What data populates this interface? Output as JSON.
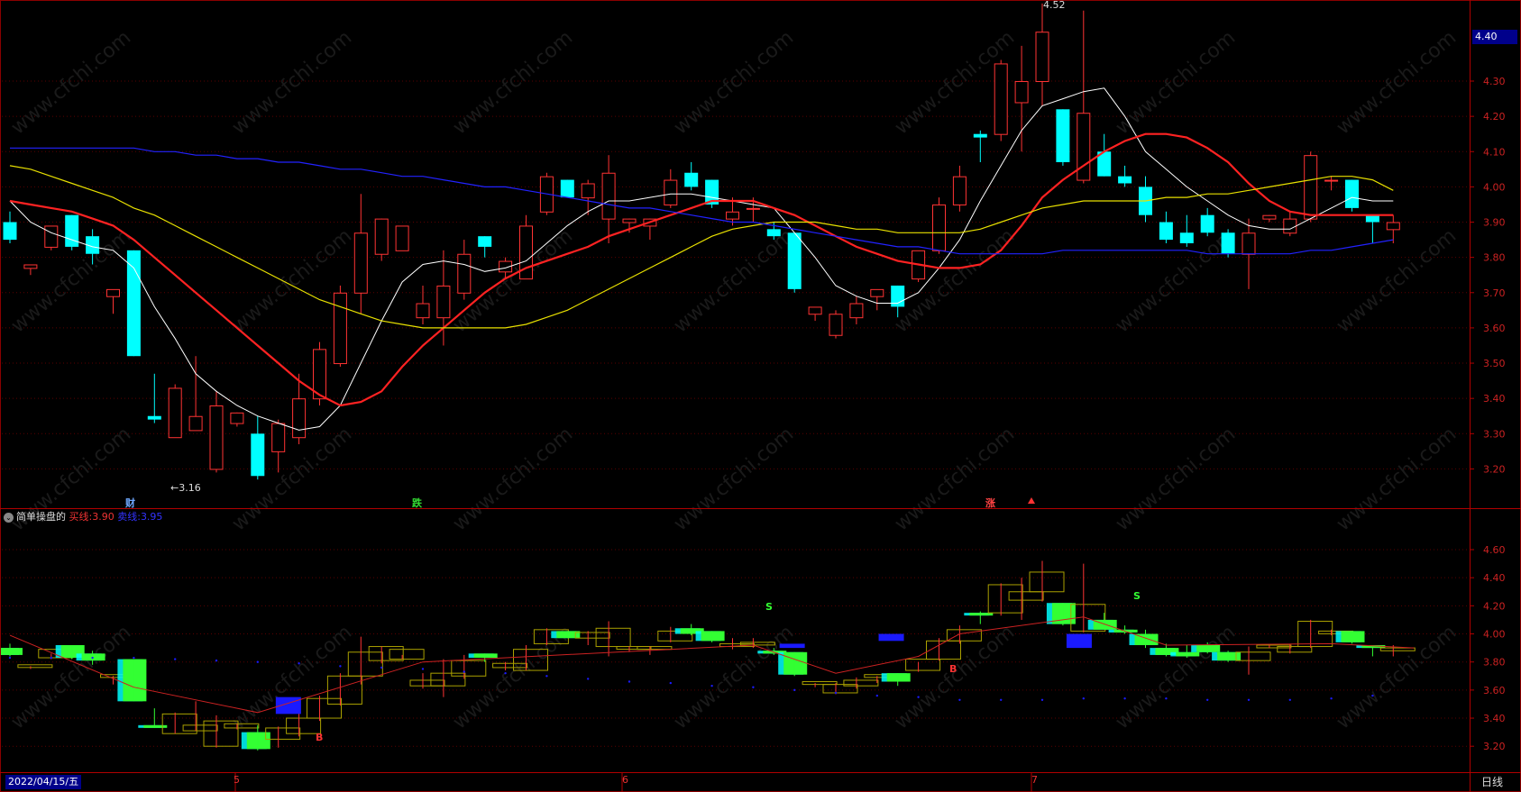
{
  "main_chart": {
    "max_label": "4.52",
    "min_label": "←3.16",
    "current_price": "4.40",
    "y_ticks": [
      "4.30",
      "4.20",
      "4.10",
      "4.00",
      "3.90",
      "3.80",
      "3.70",
      "3.60",
      "3.50",
      "3.40",
      "3.30",
      "3.20"
    ],
    "markers": [
      {
        "text": "财",
        "color": "#6ea8ff"
      },
      {
        "text": "跌",
        "color": "#33dd33"
      },
      {
        "text": "涨",
        "color": "#ff4444"
      }
    ]
  },
  "indicator": {
    "toggle_symbol": "⌄",
    "name": "简单操盘的",
    "line1_label": "买线:",
    "line1_value": "3.90",
    "line2_label": "卖线:",
    "line2_value": "3.95",
    "y_ticks": [
      "4.60",
      "4.40",
      "4.20",
      "4.00",
      "3.80",
      "3.60",
      "3.40",
      "3.20"
    ],
    "signals": [
      "B",
      "B",
      "S",
      "S"
    ]
  },
  "footer": {
    "date": "2022/04/15/五",
    "months": [
      "5",
      "6",
      "7"
    ],
    "period": "日线"
  },
  "colors": {
    "up": "#ff3333",
    "down": "#00ffff",
    "ma5": "#ffffff",
    "ma10": "#ff2222",
    "ma20": "#e8e000",
    "ma60": "#2222ff",
    "ind_down": "#33ff33",
    "ind_up": "#aaa000",
    "ind_marker": "#1a1aff"
  },
  "chart_data": {
    "type": "candlestick",
    "x": [
      1,
      2,
      3,
      4,
      5,
      6,
      7,
      8,
      9,
      10,
      11,
      12,
      13,
      14,
      15,
      16,
      17,
      18,
      19,
      20,
      21,
      22,
      23,
      24,
      25,
      26,
      27,
      28,
      29,
      30,
      31,
      32,
      33,
      34,
      35,
      36,
      37,
      38,
      39,
      40,
      41,
      42,
      43,
      44,
      45,
      46,
      47,
      48,
      49,
      50,
      51,
      52,
      53,
      54,
      55,
      56,
      57,
      58,
      59,
      60,
      61,
      62,
      63,
      64,
      65,
      66,
      67,
      68
    ],
    "ohlc": [
      [
        3.9,
        3.93,
        3.85,
        3.84
      ],
      [
        3.77,
        3.77,
        3.78,
        3.75
      ],
      [
        3.83,
        3.86,
        3.89,
        3.82
      ],
      [
        3.92,
        3.92,
        3.83,
        3.82
      ],
      [
        3.86,
        3.88,
        3.81,
        3.78
      ],
      [
        3.69,
        3.7,
        3.71,
        3.64
      ],
      [
        3.82,
        3.82,
        3.52,
        3.52
      ],
      [
        3.35,
        3.47,
        3.34,
        3.33
      ],
      [
        3.29,
        3.44,
        3.43,
        3.29
      ],
      [
        3.31,
        3.52,
        3.35,
        3.31
      ],
      [
        3.2,
        3.42,
        3.38,
        3.19
      ],
      [
        3.33,
        3.36,
        3.36,
        3.32
      ],
      [
        3.3,
        3.35,
        3.18,
        3.17
      ],
      [
        3.25,
        3.34,
        3.33,
        3.19
      ],
      [
        3.29,
        3.47,
        3.4,
        3.27
      ],
      [
        3.4,
        3.56,
        3.54,
        3.38
      ],
      [
        3.5,
        3.72,
        3.7,
        3.49
      ],
      [
        3.7,
        3.98,
        3.87,
        3.64
      ],
      [
        3.81,
        3.91,
        3.91,
        3.79
      ],
      [
        3.82,
        3.85,
        3.89,
        3.82
      ],
      [
        3.63,
        3.72,
        3.67,
        3.61
      ],
      [
        3.63,
        3.82,
        3.72,
        3.55
      ],
      [
        3.7,
        3.85,
        3.81,
        3.68
      ],
      [
        3.86,
        3.86,
        3.83,
        3.8
      ],
      [
        3.76,
        3.8,
        3.79,
        3.74
      ],
      [
        3.74,
        3.92,
        3.89,
        3.74
      ],
      [
        3.93,
        4.04,
        4.03,
        3.92
      ],
      [
        4.02,
        4.02,
        3.97,
        3.97
      ],
      [
        3.97,
        4.02,
        4.01,
        3.92
      ],
      [
        3.91,
        4.09,
        4.04,
        3.84
      ],
      [
        3.9,
        3.91,
        3.91,
        3.87
      ],
      [
        3.89,
        3.91,
        3.91,
        3.85
      ],
      [
        3.95,
        4.05,
        4.02,
        3.94
      ],
      [
        4.04,
        4.07,
        4.0,
        3.99
      ],
      [
        4.02,
        4.02,
        3.95,
        3.94
      ],
      [
        3.91,
        3.97,
        3.93,
        3.89
      ],
      [
        3.94,
        3.97,
        3.94,
        3.9
      ],
      [
        3.88,
        3.9,
        3.86,
        3.85
      ],
      [
        3.87,
        3.87,
        3.71,
        3.7
      ],
      [
        3.64,
        3.65,
        3.66,
        3.62
      ],
      [
        3.58,
        3.65,
        3.64,
        3.57
      ],
      [
        3.63,
        3.69,
        3.67,
        3.61
      ],
      [
        3.69,
        3.7,
        3.71,
        3.65
      ],
      [
        3.72,
        3.72,
        3.66,
        3.63
      ],
      [
        3.74,
        3.8,
        3.82,
        3.73
      ],
      [
        3.82,
        3.97,
        3.95,
        3.81
      ],
      [
        3.95,
        4.06,
        4.03,
        3.93
      ],
      [
        4.15,
        4.16,
        4.14,
        4.07
      ],
      [
        4.15,
        4.36,
        4.35,
        4.13
      ],
      [
        4.24,
        4.4,
        4.3,
        4.1
      ],
      [
        4.3,
        4.52,
        4.44,
        4.23
      ],
      [
        4.22,
        4.22,
        4.07,
        4.06
      ],
      [
        4.02,
        4.5,
        4.21,
        4.01
      ],
      [
        4.1,
        4.15,
        4.03,
        4.03
      ],
      [
        4.03,
        4.06,
        4.01,
        4.0
      ],
      [
        4.0,
        4.03,
        3.92,
        3.9
      ],
      [
        3.9,
        3.93,
        3.85,
        3.84
      ],
      [
        3.87,
        3.92,
        3.84,
        3.83
      ],
      [
        3.92,
        3.94,
        3.87,
        3.86
      ],
      [
        3.87,
        3.88,
        3.81,
        3.8
      ],
      [
        3.81,
        3.91,
        3.87,
        3.71
      ],
      [
        3.91,
        3.92,
        3.92,
        3.9
      ],
      [
        3.87,
        3.93,
        3.91,
        3.86
      ],
      [
        3.91,
        4.1,
        4.09,
        3.9
      ],
      [
        4.02,
        4.03,
        4.02,
        3.99
      ],
      [
        4.02,
        4.02,
        3.94,
        3.93
      ],
      [
        3.92,
        3.92,
        3.9,
        3.84
      ],
      [
        3.88,
        3.92,
        3.9,
        3.84
      ]
    ],
    "series": [
      {
        "name": "MA5",
        "values": [
          3.96,
          3.9,
          3.87,
          3.85,
          3.83,
          3.82,
          3.77,
          3.66,
          3.57,
          3.47,
          3.42,
          3.38,
          3.35,
          3.33,
          3.31,
          3.32,
          3.38,
          3.5,
          3.62,
          3.73,
          3.78,
          3.79,
          3.78,
          3.76,
          3.77,
          3.79,
          3.84,
          3.89,
          3.93,
          3.96,
          3.96,
          3.97,
          3.98,
          3.98,
          3.97,
          3.96,
          3.95,
          3.94,
          3.87,
          3.8,
          3.72,
          3.69,
          3.67,
          3.67,
          3.7,
          3.77,
          3.85,
          3.96,
          4.06,
          4.16,
          4.23,
          4.25,
          4.27,
          4.28,
          4.2,
          4.1,
          4.05,
          4.0,
          3.96,
          3.92,
          3.89,
          3.88,
          3.88,
          3.91,
          3.94,
          3.97,
          3.96,
          3.96
        ]
      },
      {
        "name": "MA10",
        "values": [
          3.96,
          3.95,
          3.94,
          3.93,
          3.91,
          3.89,
          3.85,
          3.8,
          3.75,
          3.7,
          3.65,
          3.6,
          3.55,
          3.5,
          3.45,
          3.41,
          3.38,
          3.39,
          3.42,
          3.49,
          3.55,
          3.6,
          3.65,
          3.7,
          3.74,
          3.77,
          3.79,
          3.81,
          3.83,
          3.86,
          3.88,
          3.9,
          3.92,
          3.94,
          3.96,
          3.96,
          3.96,
          3.94,
          3.92,
          3.89,
          3.86,
          3.83,
          3.81,
          3.79,
          3.78,
          3.77,
          3.77,
          3.78,
          3.82,
          3.89,
          3.97,
          4.02,
          4.06,
          4.1,
          4.13,
          4.15,
          4.15,
          4.14,
          4.11,
          4.07,
          4.01,
          3.96,
          3.93,
          3.92,
          3.92,
          3.92,
          3.92,
          3.92
        ]
      },
      {
        "name": "MA20",
        "values": [
          4.06,
          4.05,
          4.03,
          4.01,
          3.99,
          3.97,
          3.94,
          3.92,
          3.89,
          3.86,
          3.83,
          3.8,
          3.77,
          3.74,
          3.71,
          3.68,
          3.66,
          3.64,
          3.62,
          3.61,
          3.6,
          3.6,
          3.6,
          3.6,
          3.6,
          3.61,
          3.63,
          3.65,
          3.68,
          3.71,
          3.74,
          3.77,
          3.8,
          3.83,
          3.86,
          3.88,
          3.89,
          3.9,
          3.9,
          3.9,
          3.89,
          3.88,
          3.88,
          3.87,
          3.87,
          3.87,
          3.87,
          3.88,
          3.9,
          3.92,
          3.94,
          3.95,
          3.96,
          3.96,
          3.96,
          3.96,
          3.97,
          3.97,
          3.98,
          3.98,
          3.99,
          4.0,
          4.01,
          4.02,
          4.03,
          4.03,
          4.02,
          3.99
        ]
      },
      {
        "name": "MA60",
        "values": [
          4.11,
          4.11,
          4.11,
          4.11,
          4.11,
          4.11,
          4.11,
          4.1,
          4.1,
          4.09,
          4.09,
          4.08,
          4.08,
          4.07,
          4.07,
          4.06,
          4.05,
          4.05,
          4.04,
          4.03,
          4.03,
          4.02,
          4.01,
          4.0,
          4.0,
          3.99,
          3.98,
          3.97,
          3.96,
          3.95,
          3.94,
          3.94,
          3.93,
          3.92,
          3.91,
          3.9,
          3.9,
          3.89,
          3.88,
          3.87,
          3.86,
          3.85,
          3.84,
          3.83,
          3.83,
          3.82,
          3.81,
          3.81,
          3.81,
          3.81,
          3.81,
          3.82,
          3.82,
          3.82,
          3.82,
          3.82,
          3.82,
          3.82,
          3.81,
          3.81,
          3.81,
          3.81,
          3.81,
          3.82,
          3.82,
          3.83,
          3.84,
          3.85
        ]
      }
    ],
    "ylim": [
      3.1,
      4.52
    ],
    "indicator_ylim": [
      3.08,
      4.7
    ]
  }
}
